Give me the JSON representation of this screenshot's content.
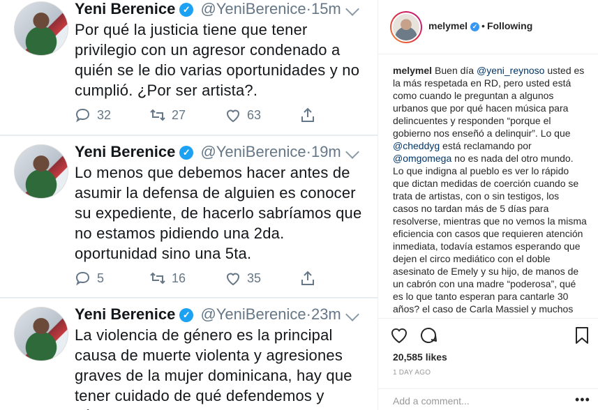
{
  "tweets": [
    {
      "name": "Yeni Berenice",
      "handle": "@YeniBerenice",
      "time": "15m",
      "text": "Por qué la justicia tiene que tener privilegio con un agresor condenado a quién se le dio varias oportunidades y no cumplió. ¿Por ser artista?.",
      "replies": "32",
      "retweets": "27",
      "likes": "63"
    },
    {
      "name": "Yeni Berenice",
      "handle": "@YeniBerenice",
      "time": "19m",
      "text": "Lo menos que debemos hacer antes de asumir la defensa de alguien es conocer su expediente, de hacerlo sabríamos que no estamos pidiendo una 2da. oportunidad sino una 5ta.",
      "replies": "5",
      "retweets": "16",
      "likes": "35"
    },
    {
      "name": "Yeni Berenice",
      "handle": "@YeniBerenice",
      "time": "23m",
      "text": "La violencia de género es la principal causa de muerte violenta y agresiones graves de la  mujer dominicana, hay que tener cuidado de qué defendemos y cómo.",
      "replies": "",
      "retweets": "",
      "likes": ""
    }
  ],
  "post": {
    "username": "melymel",
    "following_label": "Following",
    "caption_user": "melymel",
    "caption_parts": [
      {
        "t": "Buen día ",
        "m": false
      },
      {
        "t": "@yeni_reynoso",
        "m": true
      },
      {
        "t": " usted es la más respetada en RD, pero usted está como cuando le preguntan a algunos urbanos que por qué hacen música para delincuentes y responden “porque el gobierno nos enseñó a delinquir”. Lo que ",
        "m": false
      },
      {
        "t": "@cheddyg",
        "m": true
      },
      {
        "t": " está reclamando por ",
        "m": false
      },
      {
        "t": "@omgomega",
        "m": true
      },
      {
        "t": " no es nada del otro mundo. Lo que indigna al pueblo es ver lo rápido que dictan medidas de coerción cuando se trata de artistas, con o sin testigos, los casos no tardan más de 5 días para resolverse, mientras que no vemos la misma eficiencia con casos que requieren atención inmediata, todavía estamos esperando que dejen el circo mediático con el doble asesinato de Emely y su hijo, de manos de un cabrón con una madre “poderosa”, qué es lo que tanto esperan para cantarle 30 años? el caso de Carla Massiel y muchos más que no tienen fin.",
        "m": false
      }
    ],
    "likes": "20,585 likes",
    "date": "1 DAY AGO",
    "comment_placeholder": "Add a comment...",
    "more_label": "•••"
  },
  "colors": {
    "twitter_blue": "#1da1f2",
    "ig_blue": "#3897f0",
    "link": "#003569"
  },
  "icons": [
    "reply-icon",
    "retweet-icon",
    "like-icon",
    "share-icon",
    "heart-icon",
    "comment-icon",
    "bookmark-icon",
    "verified-icon"
  ]
}
